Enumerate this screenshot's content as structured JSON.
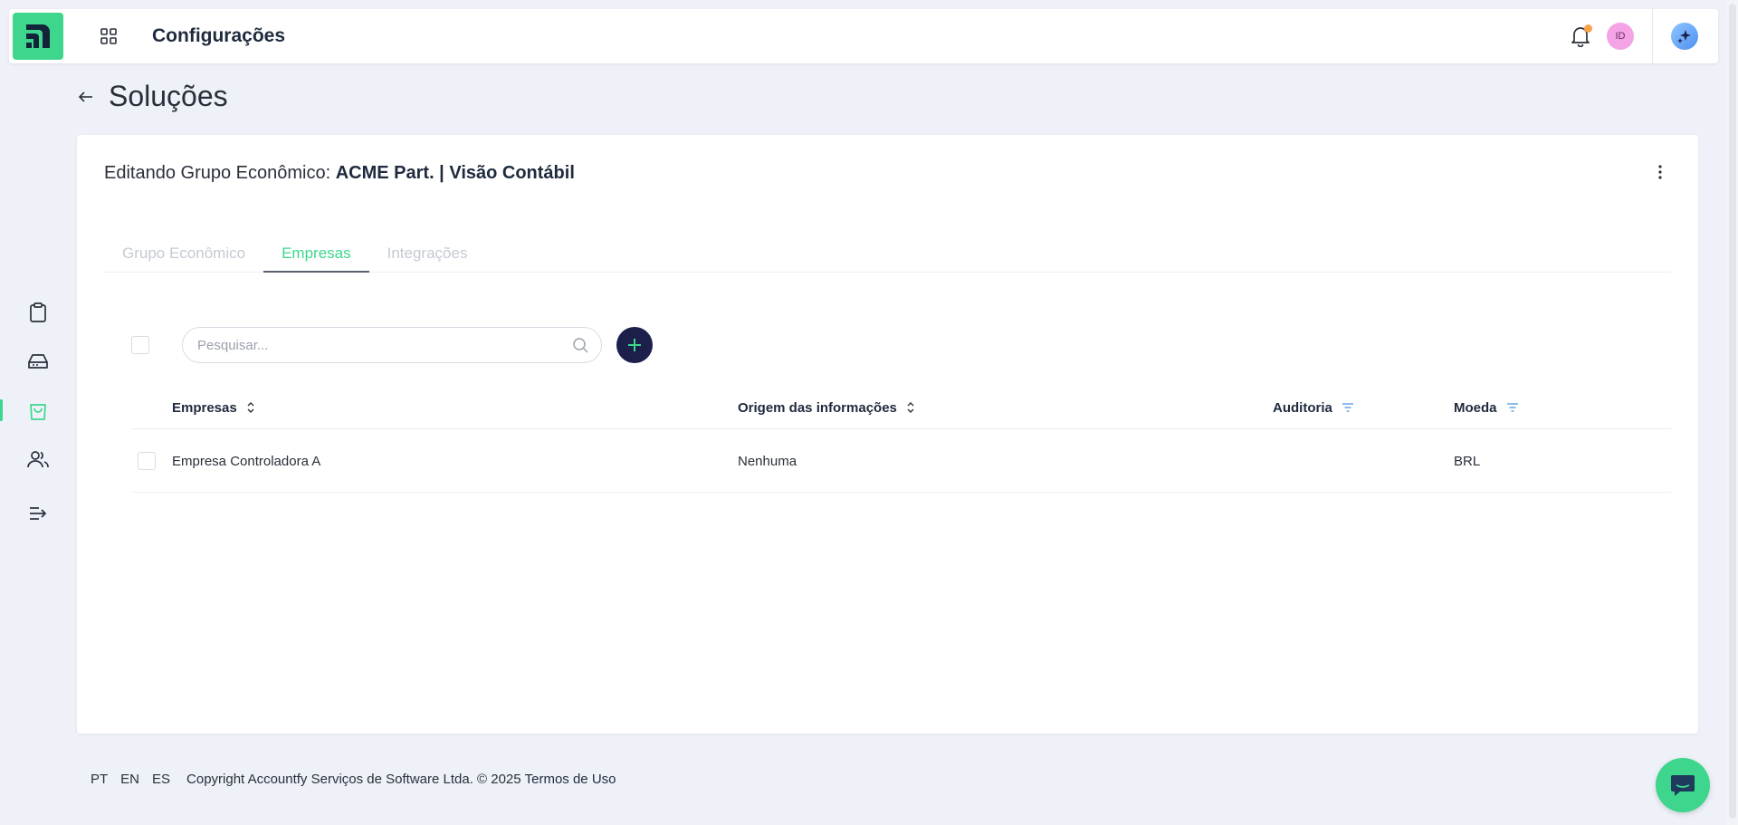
{
  "header": {
    "title": "Configurações",
    "avatar_initials": "ID"
  },
  "page": {
    "title": "Soluções"
  },
  "card": {
    "title_prefix": "Editando Grupo Econômico:",
    "title_name": "ACME Part. | Visão Contábil"
  },
  "tabs": [
    {
      "label": "Grupo Econômico",
      "active": false
    },
    {
      "label": "Empresas",
      "active": true
    },
    {
      "label": "Integrações",
      "active": false
    }
  ],
  "search": {
    "placeholder": "Pesquisar..."
  },
  "table": {
    "columns": [
      {
        "label": "Empresas",
        "icon": "sort-icon"
      },
      {
        "label": "Origem das informações",
        "icon": "sort-icon"
      },
      {
        "label": "Auditoria",
        "icon": "filter-icon"
      },
      {
        "label": "Moeda",
        "icon": "filter-icon"
      }
    ],
    "rows": [
      {
        "empresa": "Empresa Controladora A",
        "origem": "Nenhuma",
        "auditoria": "",
        "moeda": "BRL"
      }
    ]
  },
  "footer": {
    "languages": [
      "PT",
      "EN",
      "ES"
    ],
    "copyright": "Copyright Accountfy Serviços de Software Ltda. © 2025",
    "terms": "Termos de Uso"
  },
  "sidebar": {
    "items": [
      {
        "icon": "clipboard-icon",
        "active": false
      },
      {
        "icon": "hard-drive-icon",
        "active": false
      },
      {
        "icon": "shopping-bag-icon",
        "active": true
      },
      {
        "icon": "users-icon",
        "active": false
      },
      {
        "icon": "expand-menu-icon",
        "active": false
      }
    ]
  },
  "colors": {
    "accent": "#3dd68c",
    "primary_dark": "#1b1f4a",
    "background": "#eef1f8",
    "notification_dot": "#f5a24b",
    "avatar": "#f4a3e5"
  }
}
